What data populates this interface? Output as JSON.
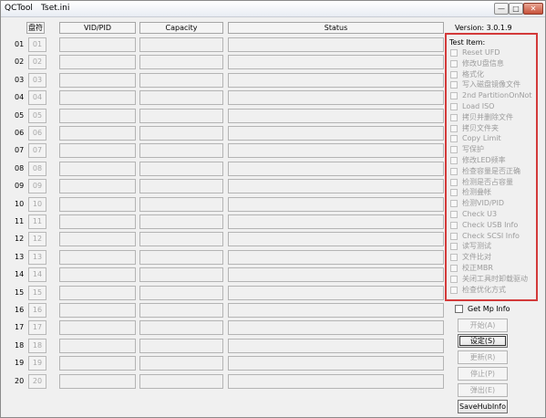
{
  "window": {
    "app_name": "QCTool",
    "ini_name": "Tset.ini",
    "min_glyph": "—",
    "max_glyph": "□",
    "close_glyph": "✕"
  },
  "table": {
    "headers": {
      "pan": "盘符",
      "vid": "VID/PID",
      "capacity": "Capacity",
      "status": "Status"
    },
    "rows": [
      {
        "num": "01",
        "btn": "01"
      },
      {
        "num": "02",
        "btn": "02"
      },
      {
        "num": "03",
        "btn": "03"
      },
      {
        "num": "04",
        "btn": "04"
      },
      {
        "num": "05",
        "btn": "05"
      },
      {
        "num": "06",
        "btn": "06"
      },
      {
        "num": "07",
        "btn": "07"
      },
      {
        "num": "08",
        "btn": "08"
      },
      {
        "num": "09",
        "btn": "09"
      },
      {
        "num": "10",
        "btn": "10"
      },
      {
        "num": "11",
        "btn": "11"
      },
      {
        "num": "12",
        "btn": "12"
      },
      {
        "num": "13",
        "btn": "13"
      },
      {
        "num": "14",
        "btn": "14"
      },
      {
        "num": "15",
        "btn": "15"
      },
      {
        "num": "16",
        "btn": "16"
      },
      {
        "num": "17",
        "btn": "17"
      },
      {
        "num": "18",
        "btn": "18"
      },
      {
        "num": "19",
        "btn": "19"
      },
      {
        "num": "20",
        "btn": "20"
      }
    ]
  },
  "version": "Version: 3.0.1.9",
  "test_item": {
    "title": "Test Item:",
    "items": [
      "Reset UFD",
      "修改U盘信息",
      "格式化",
      "写入磁盘镜像文件",
      "2nd PartitionOnNot",
      "Load ISO",
      "拷贝并删除文件",
      "拷贝文件夹",
      "Copy Limit",
      "写保护",
      "修改LED频率",
      "检查容量是否正确",
      "检测是否占容量",
      "检测叠帐",
      "检测VID/PID",
      "Check U3",
      "Check USB Info",
      "Check SCSI Info",
      "读写测试",
      "文件比对",
      "校正MBR",
      "关闭工具时卸载驱动",
      "检查优化方式"
    ]
  },
  "get_mp_info_label": "Get Mp Info",
  "actions": {
    "start": "开始(A)",
    "setup": "设定(S)",
    "update": "更新(R)",
    "stop": "停止(P)",
    "eject": "弹出(E)",
    "savehub": "SaveHubInfo"
  }
}
